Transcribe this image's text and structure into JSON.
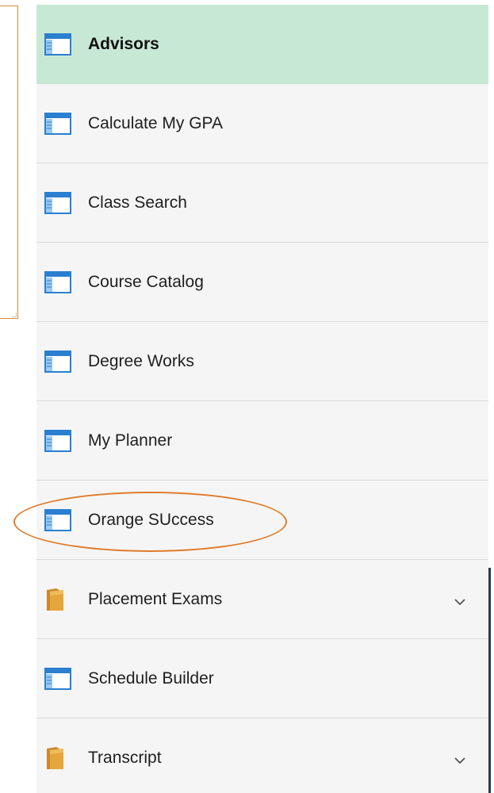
{
  "menu": {
    "items": [
      {
        "label": "Advisors",
        "icon": "navigation-page-icon",
        "active": true
      },
      {
        "label": "Calculate My GPA",
        "icon": "navigation-page-icon"
      },
      {
        "label": "Class Search",
        "icon": "navigation-page-icon"
      },
      {
        "label": "Course Catalog",
        "icon": "navigation-page-icon"
      },
      {
        "label": "Degree Works",
        "icon": "navigation-page-icon"
      },
      {
        "label": "My Planner",
        "icon": "navigation-page-icon"
      },
      {
        "label": "Orange SUccess",
        "icon": "navigation-page-icon",
        "annotated": true
      },
      {
        "label": "Placement Exams",
        "icon": "folder-icon",
        "expandable": true
      },
      {
        "label": "Schedule Builder",
        "icon": "navigation-page-icon"
      },
      {
        "label": "Transcript",
        "icon": "folder-icon",
        "expandable": true
      }
    ]
  },
  "colors": {
    "active_background": "#c8e8d6",
    "menu_background": "#f5f5f5",
    "annotation": "#e07b2a",
    "folder": "#e6a53c"
  }
}
